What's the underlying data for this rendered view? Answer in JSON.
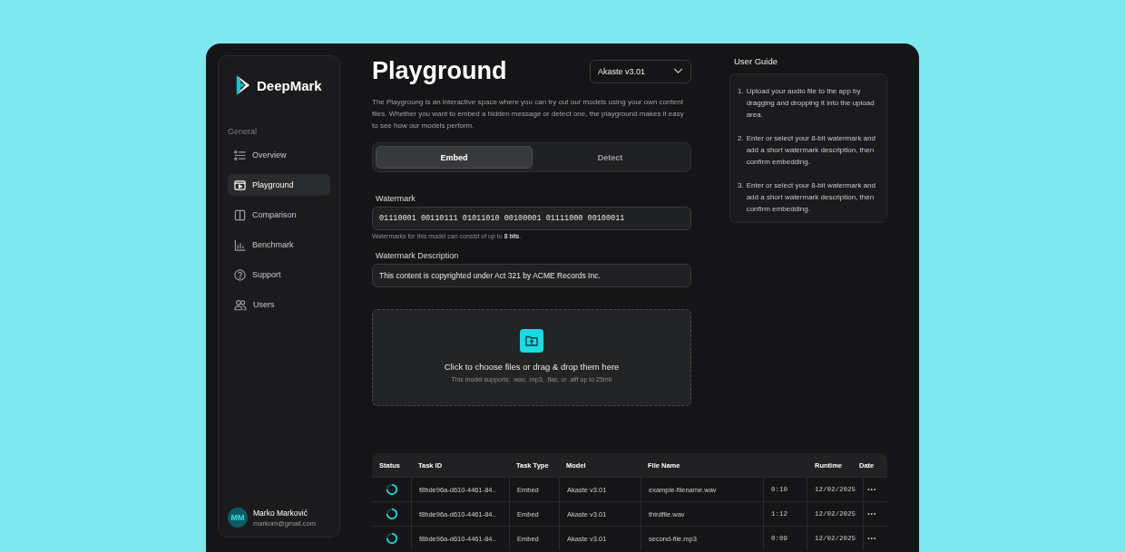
{
  "sidebar": {
    "brand": "DeepMark",
    "section": "General",
    "items": [
      {
        "kind": "overview",
        "label": "Overview",
        "selected": false
      },
      {
        "kind": "playground",
        "label": "Playground",
        "selected": true
      },
      {
        "kind": "comparison",
        "label": "Comparison",
        "selected": false
      },
      {
        "kind": "benchmark",
        "label": "Benchmark",
        "selected": false
      },
      {
        "kind": "support",
        "label": "Support",
        "selected": false
      },
      {
        "kind": "users",
        "label": "Users",
        "selected": false
      }
    ],
    "user": {
      "initials": "MM",
      "name": "Marko Marković",
      "email": "markom@gmail.com"
    }
  },
  "main": {
    "title": "Playground",
    "model_select": {
      "value": "Akaste v3.01"
    },
    "intro": "The Playgroung is an interactive space where you can try out our models using your own content files. Whether you want to embed a hidden message or detect one, the playground makes it easy to see how our models perform.",
    "tabs": [
      {
        "label": "Embed",
        "selected": true
      },
      {
        "label": "Detect",
        "selected": false
      }
    ],
    "watermark": {
      "label": "Watermark",
      "value": "01110001 00110111 01011010 00100001 01111000 00100011",
      "hint": "Watermarks for this model can consist of up to **8 bits**."
    },
    "description": {
      "label": "Watermark Description",
      "value": "This content is copyrighted under Act 321 by ACME Records Inc."
    },
    "upload": {
      "title": "Click to choose files or drag & drop them here",
      "subtitle": "This model supports: .wav, .mp3, .flac, or .aiff up to 25mb"
    }
  },
  "guide": {
    "title": "User Guide",
    "steps": [
      {
        "number": "1.",
        "text": "Upload your audio file to the app by dragging and dropping it into the upload area."
      },
      {
        "number": "2.",
        "text": "Enter or select your 8-bit watermark and add a short watermark description, then confirm embedding."
      },
      {
        "number": "3.",
        "text": "Enter or select your 8-bit watermark and add a short watermark description, then confirm embedding."
      }
    ]
  },
  "table": {
    "columns": [
      "Status",
      "Task ID",
      "Task Type",
      "Model",
      "File Name",
      "Runtime",
      "Date"
    ],
    "rows": [
      {
        "task_id": "f8bde96a-d610-4461-84..",
        "task_type": "Embed",
        "model": "Akaste v3.01",
        "file_name": "example-filename.wav",
        "runtime": "0:10",
        "date": "12/02/2025",
        "more": "···"
      },
      {
        "task_id": "f8bde96a-d610-4461-84..",
        "task_type": "Embed",
        "model": "Akaste v3.01",
        "file_name": "thirdfile.wav",
        "runtime": "1:12",
        "date": "12/02/2025",
        "more": "···"
      },
      {
        "task_id": "f8bde96a-d610-4461-84..",
        "task_type": "Embed",
        "model": "Akaste v3.01",
        "file_name": "second-file.mp3",
        "runtime": "0:09",
        "date": "12/02/2025",
        "more": "···"
      }
    ]
  }
}
